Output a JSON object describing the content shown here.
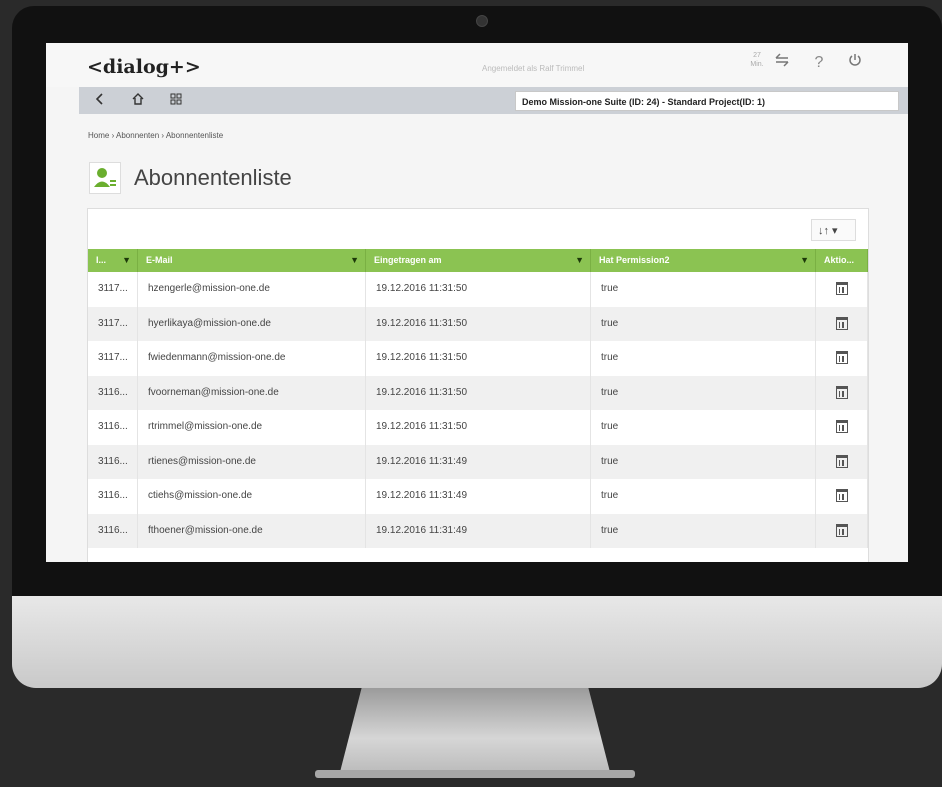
{
  "app": {
    "logo": "<dialog+>",
    "logged_in_as": "Angemeldet als Ralf Trimmel",
    "session_minutes": "27",
    "session_unit": "Min.",
    "sync_icon": "sync-icon",
    "help_label": "?",
    "power_icon": "power-icon"
  },
  "nav": {
    "back_icon": "back-icon",
    "home_icon": "home-icon",
    "grid_icon": "grid-icon",
    "project": "Demo Mission-one Suite (ID: 24) - Standard Project(ID: 1)"
  },
  "breadcrumb": "Home › Abonnenten › Abonnentenliste",
  "page": {
    "title": "Abonnentenliste",
    "icon": "subscriber-list-icon"
  },
  "toolbar": {
    "sort_label": "↓↑ ▾"
  },
  "table": {
    "columns": [
      "I...",
      "E-Mail",
      "Eingetragen am",
      "Hat Permission2",
      "Aktio..."
    ],
    "rows": [
      [
        "3117...",
        "hzengerle@mission-one.de",
        "19.12.2016 11:31:50",
        "true"
      ],
      [
        "3117...",
        "hyerlikaya@mission-one.de",
        "19.12.2016 11:31:50",
        "true"
      ],
      [
        "3117...",
        "fwiedenmann@mission-one.de",
        "19.12.2016 11:31:50",
        "true"
      ],
      [
        "3116...",
        "fvoorneman@mission-one.de",
        "19.12.2016 11:31:50",
        "true"
      ],
      [
        "3116...",
        "rtrimmel@mission-one.de",
        "19.12.2016 11:31:50",
        "true"
      ],
      [
        "3116...",
        "rtienes@mission-one.de",
        "19.12.2016 11:31:49",
        "true"
      ],
      [
        "3116...",
        "ctiehs@mission-one.de",
        "19.12.2016 11:31:49",
        "true"
      ],
      [
        "3116...",
        "fthoener@mission-one.de",
        "19.12.2016 11:31:49",
        "true"
      ]
    ]
  },
  "colors": {
    "header_green": "#8bc352",
    "accent": "#6aae2e"
  }
}
